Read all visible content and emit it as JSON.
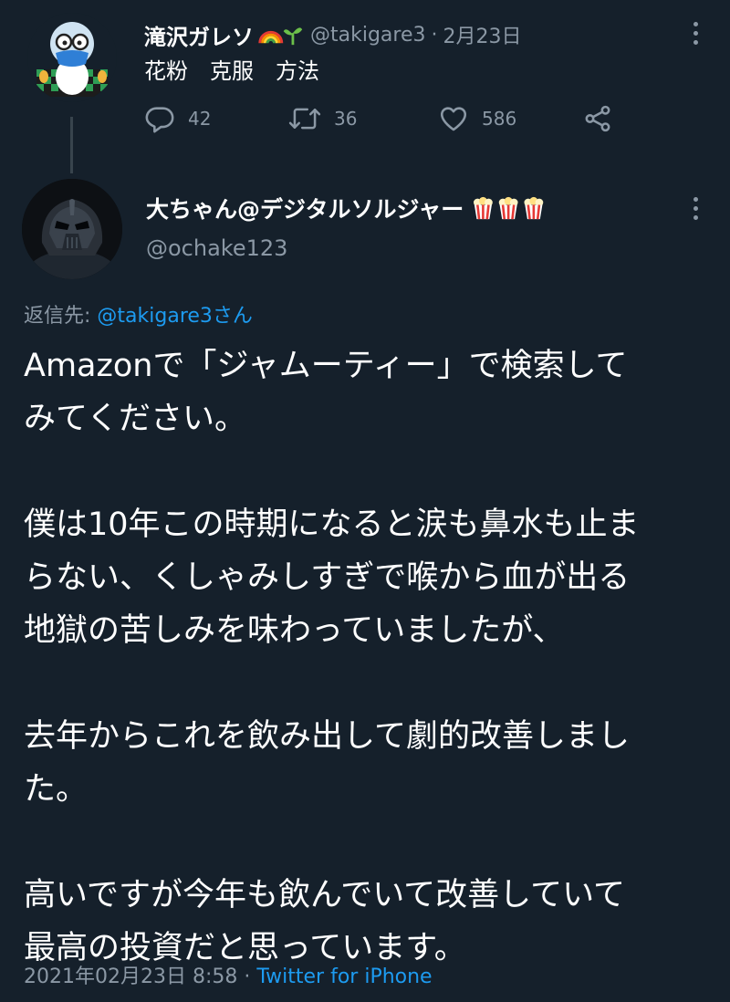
{
  "parent_tweet": {
    "display_name": "滝沢ガレソ",
    "name_emoji_icons": [
      "rainbow-icon",
      "seedling-icon"
    ],
    "handle": "@takigare3",
    "separator": "·",
    "date": "2月23日",
    "text": "花粉　克服　方法",
    "actions": {
      "reply_count": "42",
      "retweet_count": "36",
      "like_count": "586"
    }
  },
  "reply_tweet": {
    "display_name": "大ちゃん@デジタルソルジャー",
    "name_emoji_icons": [
      "popcorn-icon",
      "popcorn-icon",
      "popcorn-icon"
    ],
    "handle": "@ochake123",
    "reply_to_prefix": "返信先: ",
    "reply_to_mention": "@takigare3さん",
    "body_paragraphs": [
      "Amazonで「ジャムーティー」で検索して\nみてください。",
      "僕は10年この時期になると涙も鼻水も止ま\nらない、くしゃみしすぎで喉から血が出る\n地獄の苦しみを味わっていましたが、",
      "去年からこれを飲み出して劇的改善しまし\nた。",
      "高いですが今年も飲んでいて改善していて\n最高の投資だと思っています。"
    ],
    "timestamp": "2021年02月23日 8:58",
    "footer_separator": " · ",
    "client": "Twitter for iPhone"
  },
  "colors": {
    "background": "#15202b",
    "secondary_text": "#8b98a5",
    "link": "#1d9bf0",
    "thread_line": "#38444d"
  }
}
